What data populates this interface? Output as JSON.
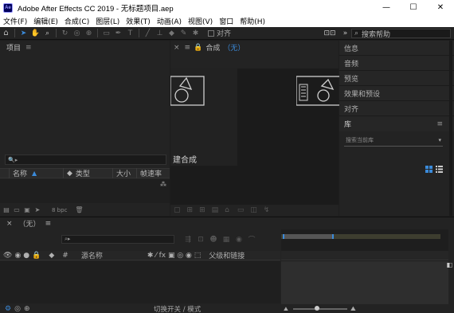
{
  "window": {
    "title": "Adobe After Effects CC 2019 - 无标题项目.aep",
    "logo_text": "Ae",
    "minimize": "—",
    "maximize": "☐",
    "close": "✕"
  },
  "menu": [
    "文件(F)",
    "编辑(E)",
    "合成(C)",
    "图层(L)",
    "效果(T)",
    "动画(A)",
    "视图(V)",
    "窗口",
    "帮助(H)"
  ],
  "toolbar": {
    "snap_label": "对齐",
    "search_placeholder": "搜索帮助"
  },
  "project": {
    "title": "项目",
    "menu_glyph": "≡",
    "search_glyph": "🔍▸",
    "columns": {
      "name": "名称",
      "type": "类型",
      "size": "大小",
      "fps": "帧速率"
    },
    "bpc": "8 bpc"
  },
  "composition": {
    "title": "合成",
    "active_name": "（无）",
    "new_comp_label": "建合成",
    "menu_glyph": "≡"
  },
  "panels": [
    "信息",
    "音频",
    "预览",
    "效果和预设",
    "对齐"
  ],
  "library": {
    "title": "库",
    "search_placeholder": "搜索当前库",
    "menu_glyph": "≡"
  },
  "timeline": {
    "tab_close": "×",
    "comp_name": "（无）",
    "menu_glyph": "≡",
    "col_source_name": "源名称",
    "col_parent": "父级和链接",
    "switch_label": "切换开关 / 模式"
  },
  "colors": {
    "accent": "#3b8ad9",
    "panel_bg": "#232323",
    "dark_bg": "#1b1b1b"
  }
}
